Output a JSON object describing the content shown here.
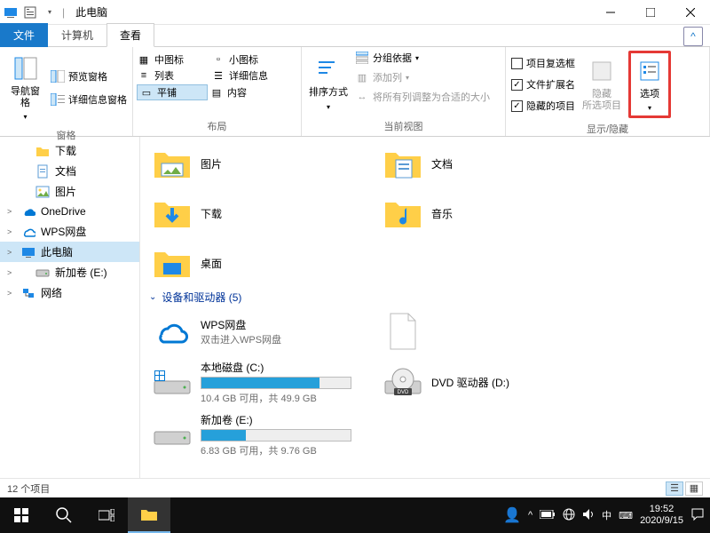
{
  "window": {
    "title": "此电脑"
  },
  "tabs": {
    "file": "文件",
    "computer": "计算机",
    "view": "查看"
  },
  "ribbon": {
    "panes": {
      "nav": {
        "btn": "导航窗格",
        "preview": "预览窗格",
        "details": "详细信息窗格",
        "label": "窗格"
      },
      "layout": {
        "medium": "中图标",
        "small": "小图标",
        "list": "列表",
        "details": "详细信息",
        "tiles": "平铺",
        "content": "内容",
        "label": "布局"
      },
      "view": {
        "sort": "排序方式",
        "groupby": "分组依据",
        "addcols": "添加列",
        "autofit": "将所有列调整为合适的大小",
        "label": "当前视图"
      },
      "showhide": {
        "checkboxes": "项目复选框",
        "ext": "文件扩展名",
        "hidden": "隐藏的项目",
        "hidebtn": "隐藏",
        "hidebtn2": "所选项目",
        "options": "选项",
        "label": "显示/隐藏"
      }
    }
  },
  "nav": {
    "items": [
      {
        "label": "下载",
        "icon": "folder",
        "sub": true
      },
      {
        "label": "文档",
        "icon": "doc",
        "sub": true
      },
      {
        "label": "图片",
        "icon": "pic",
        "sub": true
      },
      {
        "label": "OneDrive",
        "icon": "onedrive",
        "sub": false,
        "exp": ">"
      },
      {
        "label": "WPS网盘",
        "icon": "cloud",
        "sub": false,
        "exp": ">"
      },
      {
        "label": "此电脑",
        "icon": "pc",
        "sub": false,
        "sel": true,
        "exp": ">"
      },
      {
        "label": "新加卷 (E:)",
        "icon": "drive",
        "sub": true,
        "exp": ">"
      },
      {
        "label": "网络",
        "icon": "net",
        "sub": false,
        "exp": ">"
      }
    ]
  },
  "content": {
    "folders": [
      {
        "name": "图片",
        "icon": "pictures"
      },
      {
        "name": "文档",
        "icon": "documents"
      },
      {
        "name": "下载",
        "icon": "downloads"
      },
      {
        "name": "音乐",
        "icon": "music"
      },
      {
        "name": "桌面",
        "icon": "desktop"
      }
    ],
    "groupHeader": "设备和驱动器 (5)",
    "drives": [
      {
        "name": "WPS网盘",
        "sub": "双击进入WPS网盘",
        "icon": "cloud"
      },
      {
        "name": "",
        "sub": "",
        "icon": "blank"
      },
      {
        "name": "本地磁盘 (C:)",
        "sub": "10.4 GB 可用，共 49.9 GB",
        "icon": "osdrive",
        "fill": 79
      },
      {
        "name": "DVD 驱动器 (D:)",
        "sub": "",
        "icon": "dvd"
      },
      {
        "name": "新加卷 (E:)",
        "sub": "6.83 GB 可用，共 9.76 GB",
        "icon": "drive",
        "fill": 30
      }
    ]
  },
  "status": {
    "text": "12 个项目"
  },
  "taskbar": {
    "time": "19:52",
    "date": "2020/9/15",
    "ime": "中"
  }
}
